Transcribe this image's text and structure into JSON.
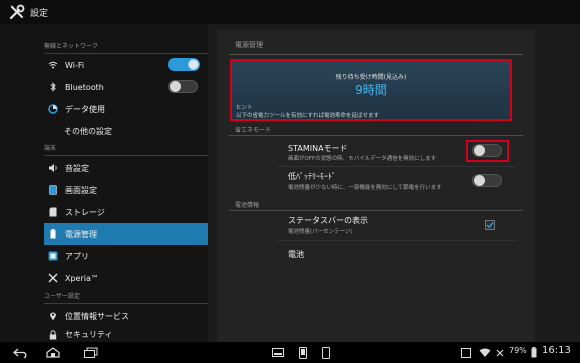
{
  "app": {
    "title": "設定",
    "icon": "settings-tools-icon"
  },
  "sidebar": {
    "sections": [
      {
        "header": "無線とネットワーク"
      },
      {
        "header": "端末"
      },
      {
        "header": "ユーザー設定"
      }
    ],
    "items": [
      {
        "label": "Wi-Fi",
        "icon": "wifi-icon",
        "toggle": "on"
      },
      {
        "label": "Bluetooth",
        "icon": "bluetooth-icon",
        "toggle": "off"
      },
      {
        "label": "データ使用",
        "icon": "data-usage-icon"
      },
      {
        "label": "その他の設定",
        "icon": ""
      },
      {
        "label": "音設定",
        "icon": "sound-icon"
      },
      {
        "label": "画面設定",
        "icon": "display-icon"
      },
      {
        "label": "ストレージ",
        "icon": "storage-icon"
      },
      {
        "label": "電源管理",
        "icon": "battery-icon",
        "selected": true
      },
      {
        "label": "アプリ",
        "icon": "apps-icon"
      },
      {
        "label": "Xperia™",
        "icon": "xperia-icon"
      },
      {
        "label": "位置情報サービス",
        "icon": "location-icon"
      },
      {
        "label": "セキュリティ",
        "icon": "lock-icon"
      }
    ]
  },
  "main": {
    "title": "電源管理",
    "standby": {
      "label": "残り待ち受け時間(見込み)",
      "value": "9時間",
      "hint_label": "ヒント",
      "hint_text": "以下の省電力ツールを有効にすれば電池寿命を延ばせます"
    },
    "power_saving": {
      "header": "省エネモード",
      "stamina": {
        "title": "STAMINAモード",
        "sub": "画面がOFFの状態の時、モバイルデータ通信を無効にします",
        "toggle": "off"
      },
      "low_battery": {
        "title": "低ﾊﾞｯﾃﾘｰﾓｰﾄﾞ",
        "sub": "電池残量が少ない時に、一部機能を無効にして節電を行います",
        "toggle": "off"
      }
    },
    "battery_info": {
      "header": "電池情報",
      "status_bar": {
        "title": "ステータスバーの表示",
        "sub": "電池残量(パーセンテージ)",
        "checked": true
      },
      "battery": {
        "title": "電池"
      }
    }
  },
  "statusbar": {
    "battery_percent": "79%",
    "time": "16:13"
  },
  "colors": {
    "accent": "#2b9ad8",
    "selected": "#1f7ab0",
    "highlight": "#d4001a",
    "value": "#49b4ec"
  }
}
